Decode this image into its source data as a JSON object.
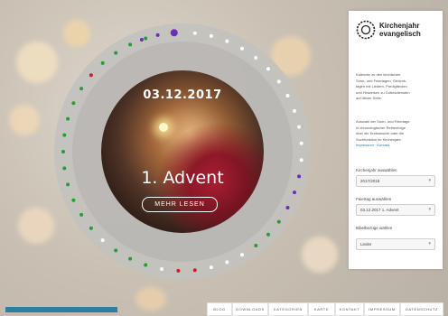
{
  "background": {
    "accent": "#2d7ea0",
    "blue_bar": "#2d7ea0"
  },
  "feature": {
    "date": "03.12.2017",
    "title": "1. Advent",
    "more_button": "MEHR LESEN"
  },
  "wheel": {
    "dots": [
      {
        "deg": -4,
        "color": "#6a2fb5",
        "big": true
      },
      {
        "deg": -12,
        "color": "#6a2fb5"
      },
      {
        "deg": -20,
        "color": "#6a2fb5"
      },
      {
        "deg": 6,
        "color": "#ffffff"
      },
      {
        "deg": 14,
        "color": "#ffffff"
      },
      {
        "deg": 22,
        "color": "#ffffff"
      },
      {
        "deg": 30,
        "color": "#ffffff"
      },
      {
        "deg": 38,
        "color": "#ffffff"
      },
      {
        "deg": 46,
        "color": "#ffffff"
      },
      {
        "deg": 54,
        "color": "#ffffff"
      },
      {
        "deg": 62,
        "color": "#ffffff"
      },
      {
        "deg": 70,
        "color": "#ffffff"
      },
      {
        "deg": 78,
        "color": "#ffffff"
      },
      {
        "deg": 86,
        "color": "#ffffff"
      },
      {
        "deg": 94,
        "color": "#ffffff"
      },
      {
        "deg": 102,
        "color": "#6a2fb5"
      },
      {
        "deg": 110,
        "color": "#6a2fb5"
      },
      {
        "deg": 118,
        "color": "#6a2fb5"
      },
      {
        "deg": 126,
        "color": "#2a9a3a"
      },
      {
        "deg": 134,
        "color": "#2a9a3a"
      },
      {
        "deg": 142,
        "color": "#2a9a3a"
      },
      {
        "deg": 150,
        "color": "#ffffff"
      },
      {
        "deg": 158,
        "color": "#ffffff"
      },
      {
        "deg": 166,
        "color": "#ffffff"
      },
      {
        "deg": 174,
        "color": "#c8202c"
      },
      {
        "deg": 182,
        "color": "#c8202c"
      },
      {
        "deg": 190,
        "color": "#ffffff"
      },
      {
        "deg": 198,
        "color": "#2a9a3a"
      },
      {
        "deg": 206,
        "color": "#2a9a3a"
      },
      {
        "deg": 214,
        "color": "#2a9a3a"
      },
      {
        "deg": 222,
        "color": "#ffffff"
      },
      {
        "deg": 230,
        "color": "#2a9a3a"
      },
      {
        "deg": 238,
        "color": "#2a9a3a"
      },
      {
        "deg": 246,
        "color": "#2a9a3a"
      },
      {
        "deg": 254,
        "color": "#2a9a3a"
      },
      {
        "deg": 262,
        "color": "#2a9a3a"
      },
      {
        "deg": 270,
        "color": "#2a9a3a"
      },
      {
        "deg": 278,
        "color": "#2a9a3a"
      },
      {
        "deg": 286,
        "color": "#2a9a3a"
      },
      {
        "deg": 294,
        "color": "#2a9a3a"
      },
      {
        "deg": 302,
        "color": "#2a9a3a"
      },
      {
        "deg": 310,
        "color": "#c8202c"
      },
      {
        "deg": 318,
        "color": "#2a9a3a"
      },
      {
        "deg": 326,
        "color": "#2a9a3a"
      },
      {
        "deg": 334,
        "color": "#2a9a3a"
      },
      {
        "deg": 342,
        "color": "#2a9a3a"
      }
    ]
  },
  "sidebar": {
    "brand_line1": "Kirchenjahr",
    "brand_line2": "evangelisch",
    "intro_lines": [
      "Kalender zu den kirchlichen",
      "Sonn- und Feiertagen, Gedenk-",
      "tagen mit Liedern, Predigttexten",
      "und Hinweisen zu Gottesdiensten",
      "auf dieser Seite."
    ],
    "note_lines": [
      "Auswahl der Sonn- und Feiertage",
      "in chronologischer Reihenfolge",
      "über die Kreisansicht oder die",
      "Suchfunktion im Kirchenjahr.",
      "Impressum · Kontakt"
    ],
    "selects": [
      {
        "label": "Kirchenjahr auswählen",
        "value": "2017/2018"
      },
      {
        "label": "Feiertag auswählen",
        "value": "03.12.2017 1. Advent"
      },
      {
        "label": "Bibelbezüge wählen",
        "value": "Lieder"
      }
    ]
  },
  "footer_nav": [
    "BLOG",
    "DOWNLOADS",
    "KATEGORIEN",
    "KARTE",
    "KONTAKT",
    "IMPRESSUM",
    "DATENSCHUTZ"
  ]
}
